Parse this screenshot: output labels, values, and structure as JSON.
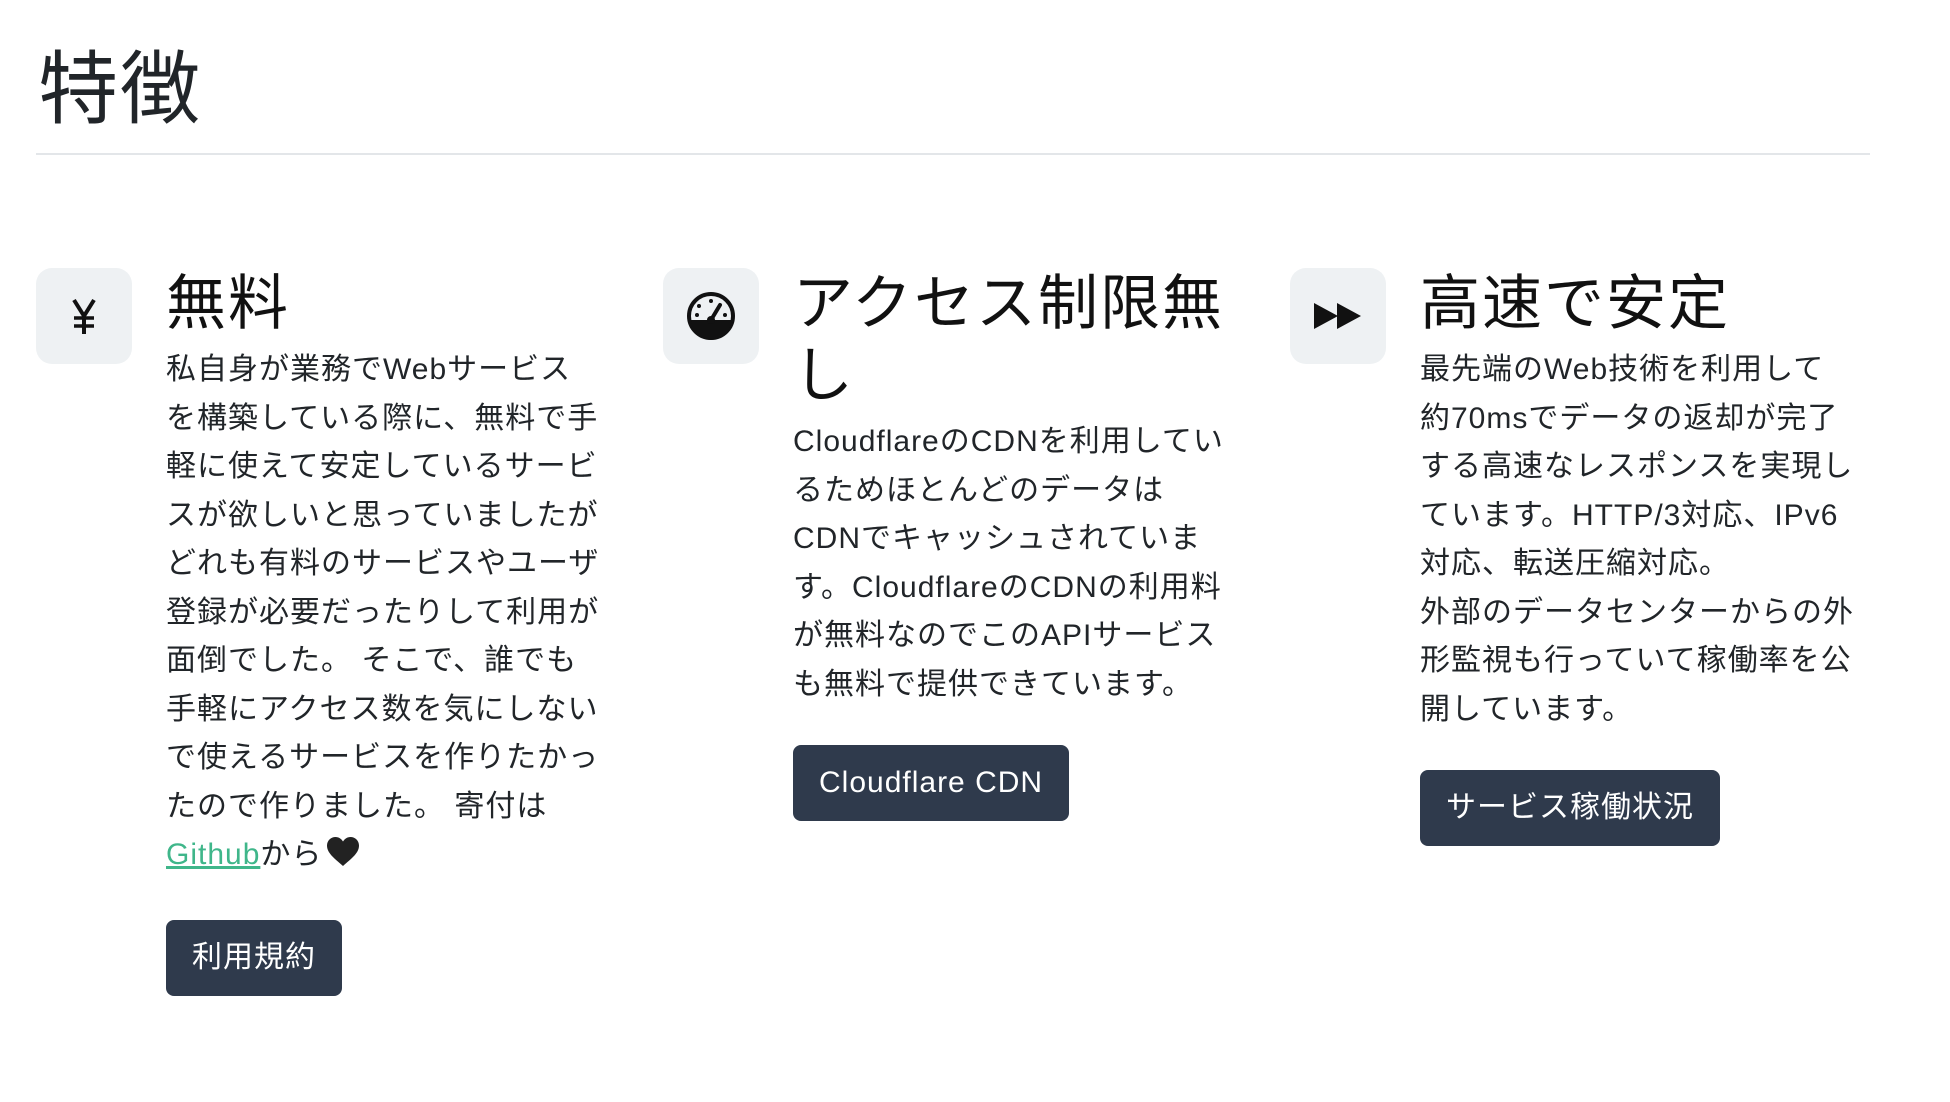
{
  "page": {
    "title": "特徴"
  },
  "features": [
    {
      "icon": "yen-icon",
      "title": "無料",
      "description": "私自身が業務でWebサービス\nを構築している際に、無料で手\n軽に使えて安定しているサービ\nスが欲しいと思っていましたが\nどれも有料のサービスやユーザ\n登録が必要だったりして利用が\n面倒でした。 そこで、誰でも\n手軽にアクセス数を気にしない\nで使えるサービスを作りたかっ\nたので作りました。 寄付は\n",
      "link_label": "Github",
      "after_link": "から",
      "button_label": "利用規約"
    },
    {
      "icon": "speedometer-icon",
      "title": "アクセス制限無し",
      "description": "CloudflareのCDNを利用してい\nるためほとんどのデータは\nCDNでキャッシュされていま\nす。CloudflareのCDNの利用料\nが無料なのでこのAPIサービス\nも無料で提供できています。",
      "button_label": "Cloudflare CDN"
    },
    {
      "icon": "fast-forward-icon",
      "title": "高速で安定",
      "description": "最先端のWeb技術を利用して\n約70msでデータの返却が完了\nする高速なレスポンスを実現し\nています。HTTP/3対応、IPv6\n対応、転送圧縮対応。\n外部のデータセンターからの外\n形監視も行っていて稼働率を公\n開しています。",
      "button_label": "サービス稼働状況"
    }
  ],
  "colors": {
    "button_bg": "#2f3a4c",
    "link": "#3fb68a",
    "icon_bg": "#eef1f3"
  }
}
